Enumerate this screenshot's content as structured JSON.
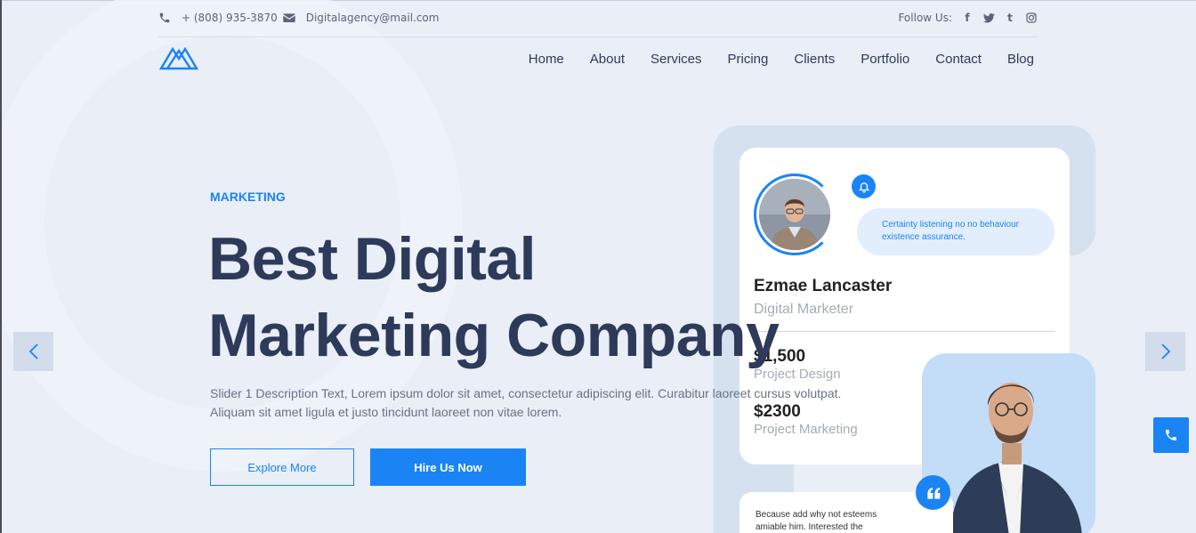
{
  "topbar": {
    "phone": "+ (808) 935-3870",
    "email": "Digitalagency@mail.com",
    "follow_label": "Follow Us:",
    "social_icons": [
      "facebook-icon",
      "twitter-icon",
      "tumblr-icon",
      "instagram-icon"
    ]
  },
  "nav": {
    "items": [
      {
        "label": "Home"
      },
      {
        "label": "About"
      },
      {
        "label": "Services"
      },
      {
        "label": "Pricing"
      },
      {
        "label": "Clients"
      },
      {
        "label": "Portfolio"
      },
      {
        "label": "Contact"
      },
      {
        "label": "Blog"
      }
    ]
  },
  "hero": {
    "eyebrow": "MARKETING",
    "headline_line1": "Best Digital",
    "headline_line2": "Marketing Company",
    "description": "Slider 1 Description Text, Lorem ipsum dolor sit amet, consectetur adipiscing elit. Curabitur laoreet cursus volutpat. Aliquam sit amet ligula et justo tincidunt laoreet non vitae lorem.",
    "explore_label": "Explore More",
    "hire_label": "Hire Us Now"
  },
  "profile_card": {
    "bubble_text": "Certainty listening no no behaviour existence assurance.",
    "name": "Ezmae Lancaster",
    "role": "Digital Marketer",
    "stats": [
      {
        "value": "$1,500",
        "label": "Project Design"
      },
      {
        "value": "$2300",
        "label": "Project Marketing"
      }
    ]
  },
  "quote": {
    "text": "Because add why not esteems amiable him. Interested the"
  },
  "colors": {
    "accent": "#1a84f5",
    "heading": "#2e3a59",
    "background": "#e9eef7"
  }
}
